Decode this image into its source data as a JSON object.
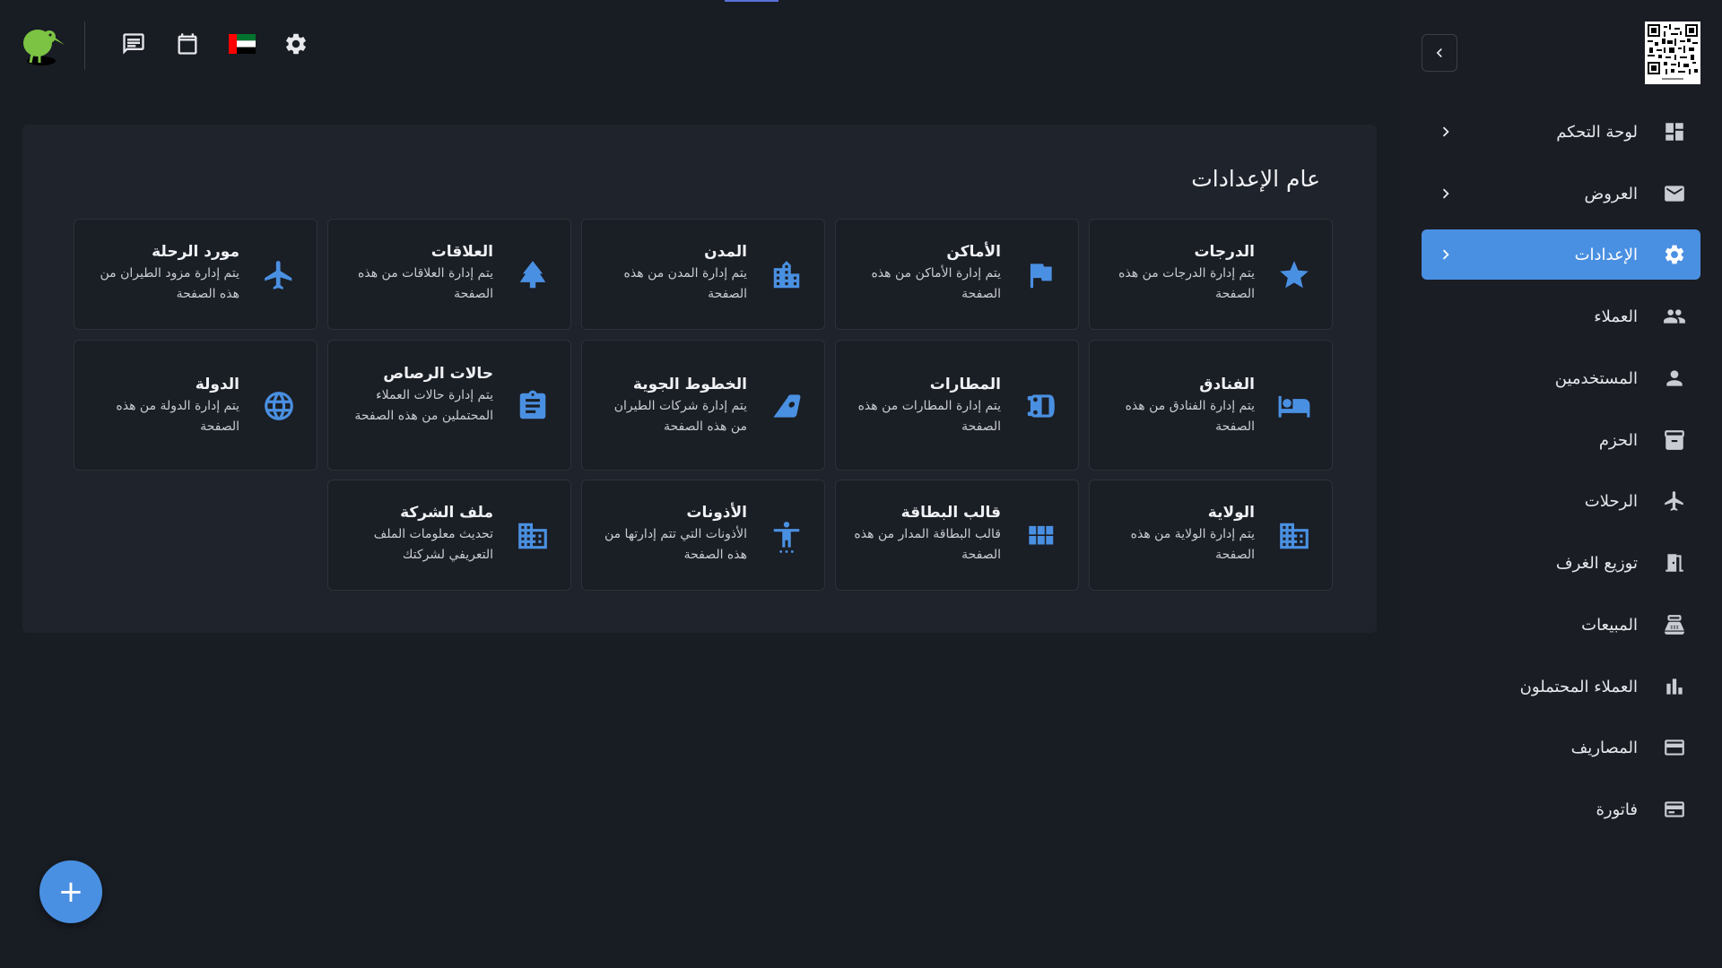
{
  "header": {
    "icons": [
      "chat-icon",
      "calendar-icon",
      "uae-flag-icon",
      "settings-gear-icon"
    ]
  },
  "settings": {
    "title": "عام الإعدادات",
    "tiles": [
      {
        "title": "الدرجات",
        "desc": "يتم إدارة الدرجات من هذه الصفحة",
        "icon": "star-icon"
      },
      {
        "title": "الأماكن",
        "desc": "يتم إدارة الأماكن من هذه الصفحة",
        "icon": "flag-icon"
      },
      {
        "title": "المدن",
        "desc": "يتم إدارة المدن من هذه الصفحة",
        "icon": "city-icon"
      },
      {
        "title": "العلاقات",
        "desc": "يتم إدارة العلاقات من هذه الصفحة",
        "icon": "tree-icon"
      },
      {
        "title": "مورد الرحلة",
        "desc": "يتم إدارة مزود الطيران من هذه الصفحة",
        "icon": "airplane-icon"
      },
      {
        "title": "الفنادق",
        "desc": "يتم إدارة الفنادق من هذه الصفحة",
        "icon": "bed-icon"
      },
      {
        "title": "المطارات",
        "desc": "يتم إدارة المطارات من هذه الصفحة",
        "icon": "bus-icon"
      },
      {
        "title": "الخطوط الجوية",
        "desc": "يتم إدارة شركات الطيران من هذه الصفحة",
        "icon": "airline-icon"
      },
      {
        "title": "حالات الرصاص",
        "desc": "يتم إدارة حالات العملاء المحتملين من هذه الصفحة",
        "icon": "clipboard-icon"
      },
      {
        "title": "الدولة",
        "desc": "يتم إدارة الدولة من هذه الصفحة",
        "icon": "globe-icon"
      },
      {
        "title": "الولاية",
        "desc": "يتم إدارة الولاية من هذه الصفحة",
        "icon": "building-icon"
      },
      {
        "title": "قالب البطاقة",
        "desc": "قالب البطاقة المدار من هذه الصفحة",
        "icon": "grid-icon"
      },
      {
        "title": "الأذونات",
        "desc": "الأذونات التي تتم إدارتها من هذه الصفحة",
        "icon": "accessibility-icon"
      },
      {
        "title": "ملف الشركة",
        "desc": "تحديث معلومات الملف التعريفي لشركتك",
        "icon": "company-icon"
      }
    ]
  },
  "sidebar": {
    "items": [
      {
        "label": "لوحة التحكم",
        "icon": "dashboard-icon",
        "chevron": true,
        "active": false
      },
      {
        "label": "العروض",
        "icon": "mail-icon",
        "chevron": true,
        "active": false
      },
      {
        "label": "الإعدادات",
        "icon": "gear-icon",
        "chevron": true,
        "active": true
      },
      {
        "label": "العملاء",
        "icon": "people-icon",
        "chevron": false,
        "active": false
      },
      {
        "label": "المستخدمين",
        "icon": "person-icon",
        "chevron": false,
        "active": false
      },
      {
        "label": "الحزم",
        "icon": "archive-icon",
        "chevron": false,
        "active": false
      },
      {
        "label": "الرحلات",
        "icon": "airplane-icon",
        "chevron": false,
        "active": false
      },
      {
        "label": "توزيع الغرف",
        "icon": "door-icon",
        "chevron": false,
        "active": false
      },
      {
        "label": "المبيعات",
        "icon": "register-icon",
        "chevron": false,
        "active": false
      },
      {
        "label": "العملاء المحتملون",
        "icon": "bar-chart-icon",
        "chevron": false,
        "active": false
      },
      {
        "label": "المصاريف",
        "icon": "credit-card-icon",
        "chevron": false,
        "active": false
      },
      {
        "label": "فاتورة",
        "icon": "wallet-icon",
        "chevron": false,
        "active": false
      }
    ]
  },
  "fab": {
    "label": "+"
  },
  "colors": {
    "accent": "#4a90e2",
    "background": "#181c23",
    "card": "#1f232b",
    "sidebar": "#1a1d24"
  }
}
